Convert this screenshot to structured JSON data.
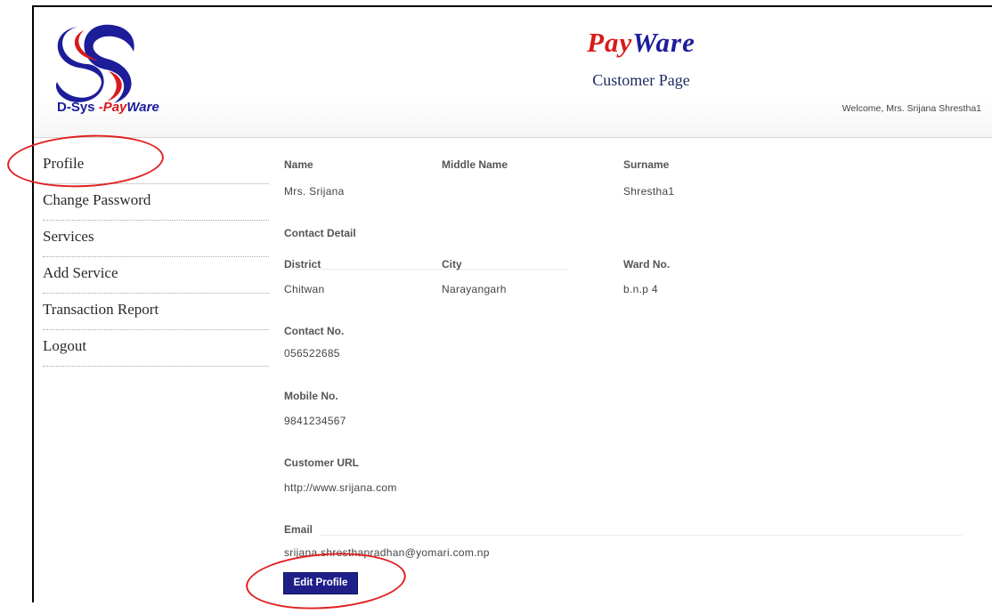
{
  "header": {
    "logo_text": {
      "prefix": "D-Sys",
      "sep": " -",
      "brand_a": "Pay",
      "brand_b": "Ware"
    },
    "brand_a": "Pay",
    "brand_b": "Ware",
    "subtitle": "Customer Page",
    "welcome": "Welcome, Mrs. Srijana Shrestha1"
  },
  "sidebar": {
    "items": [
      {
        "label": "Profile"
      },
      {
        "label": "Change Password"
      },
      {
        "label": "Services"
      },
      {
        "label": "Add Service"
      },
      {
        "label": "Transaction Report"
      },
      {
        "label": "Logout"
      }
    ]
  },
  "profile": {
    "name_label": "Name",
    "middle_name_label": "Middle Name",
    "surname_label": "Surname",
    "name_value": "Mrs. Srijana",
    "middle_name_value": "",
    "surname_value": "Shrestha1",
    "contact_detail_label": "Contact Detail",
    "district_label": "District",
    "city_label": "City",
    "ward_label": "Ward No.",
    "district_value": "Chitwan",
    "city_value": "Narayangarh",
    "ward_value": "b.n.p 4",
    "contact_no_label": "Contact No.",
    "contact_no_value": "056522685",
    "mobile_no_label": "Mobile No.",
    "mobile_no_value": "9841234567",
    "customer_url_label": "Customer URL",
    "customer_url_value": "http://www.srijana.com",
    "email_label": "Email",
    "email_value": "srijana.shresthapradhan@yomari.com.np",
    "edit_button": "Edit Profile"
  },
  "colors": {
    "brand_red": "#d81a1a",
    "brand_blue": "#1d1d9a",
    "button_bg": "#1f1f8a",
    "annotation": "#e02020"
  }
}
